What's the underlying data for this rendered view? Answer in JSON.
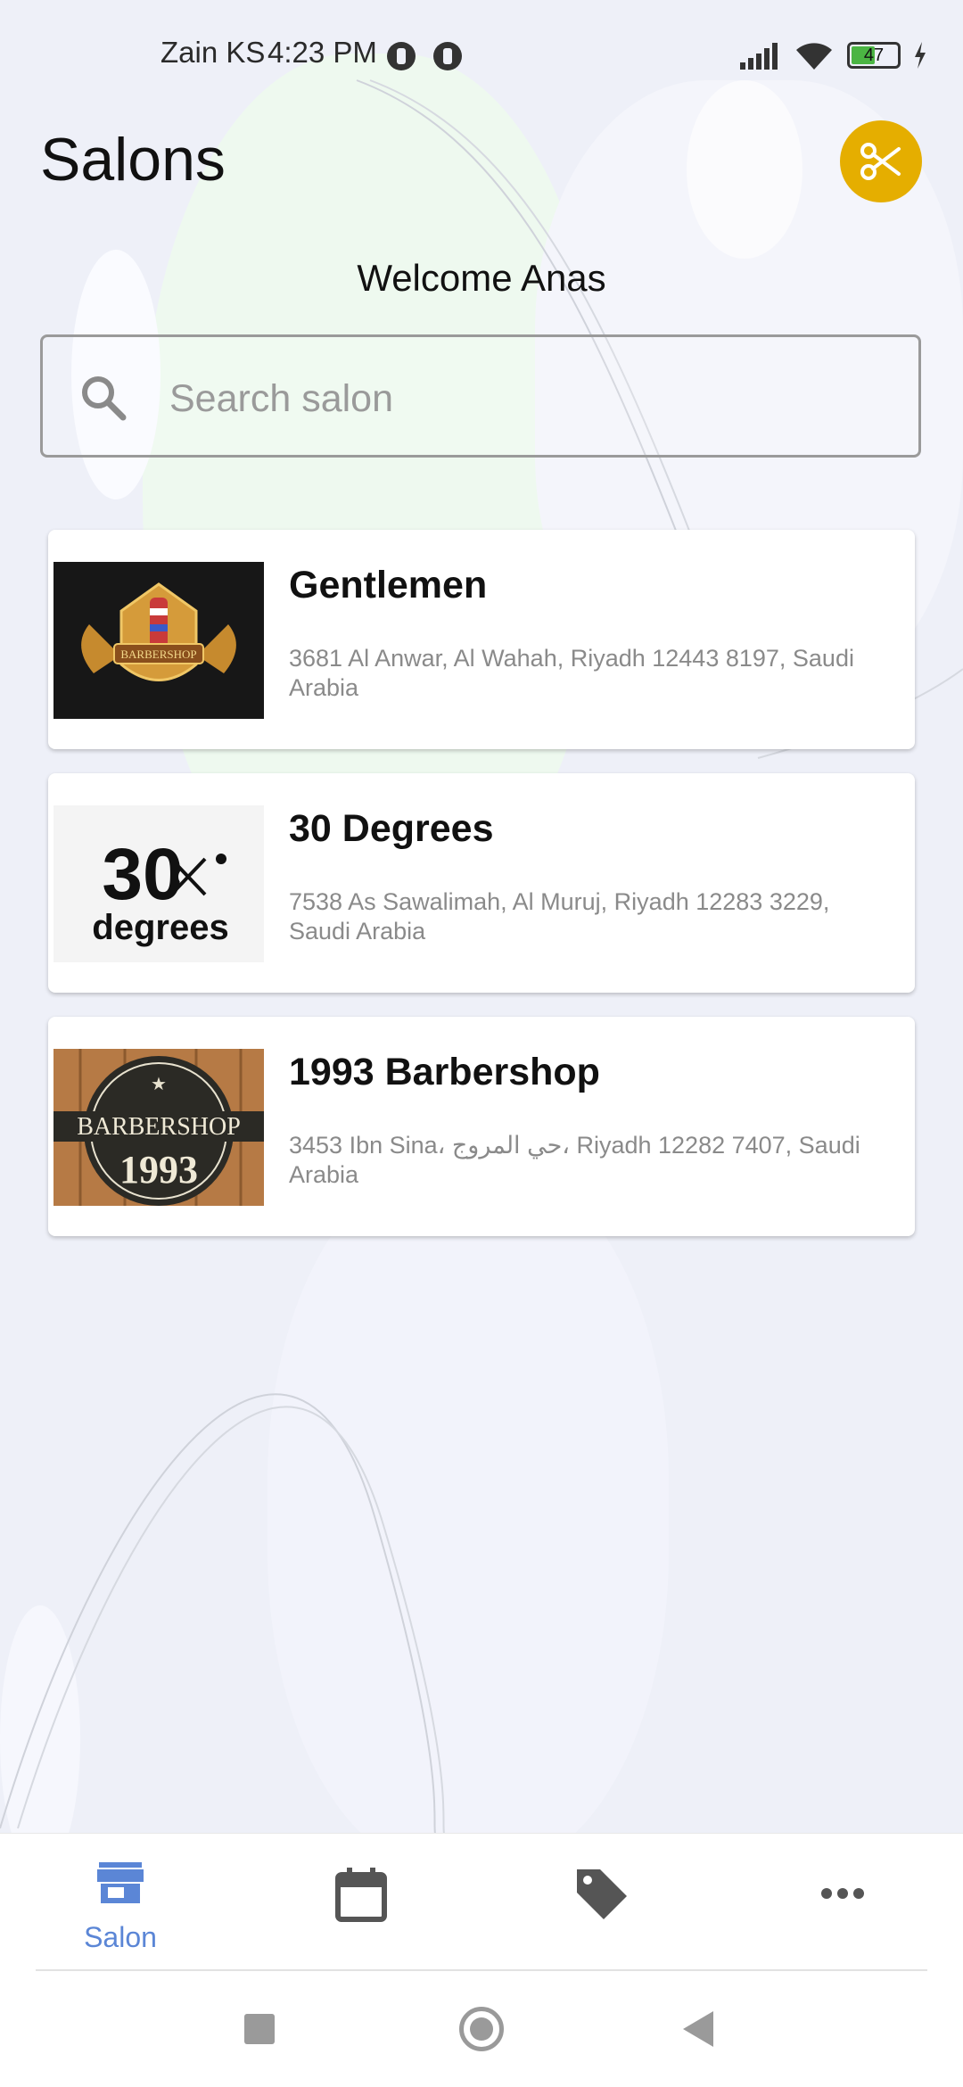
{
  "status_bar": {
    "carrier": "Zain KS",
    "time": "4:23 PM",
    "battery": "47",
    "icons": [
      "notification-icon",
      "notification-icon",
      "signal-icon",
      "wifi-icon",
      "battery-icon",
      "charging-icon"
    ]
  },
  "header": {
    "title": "Salons",
    "action_icon": "scissors-icon",
    "accent_color": "#e5ae00"
  },
  "welcome_text": "Welcome Anas",
  "search": {
    "placeholder": "Search salon",
    "value": "",
    "icon": "search-icon"
  },
  "salons": [
    {
      "name": "Gentlemen",
      "address": "3681 Al Anwar, Al Wahah, Riyadh 12443 8197, Saudi Arabia",
      "logo_text": "BARBERSHOP"
    },
    {
      "name": "30 Degrees",
      "address": "7538 As Sawalimah, Al Muruj, Riyadh 12283 3229, Saudi Arabia",
      "logo_text_top": "30",
      "logo_text_bottom": "degrees"
    },
    {
      "name": "1993 Barbershop",
      "address": "3453 Ibn Sina، حي المروج، Riyadh 12282 7407, Saudi Arabia",
      "logo_text_top": "BARBERSHOP",
      "logo_text_bottom": "1993"
    }
  ],
  "bottom_nav": {
    "items": [
      {
        "label": "Salon",
        "icon": "store-icon",
        "active": true
      },
      {
        "label": "",
        "icon": "calendar-icon",
        "active": false
      },
      {
        "label": "",
        "icon": "tag-icon",
        "active": false
      },
      {
        "label": "",
        "icon": "more-icon",
        "active": false
      }
    ],
    "active_color": "#5b86d6",
    "inactive_color": "#555555"
  },
  "system_nav": [
    "recents-button",
    "home-button",
    "back-button"
  ]
}
